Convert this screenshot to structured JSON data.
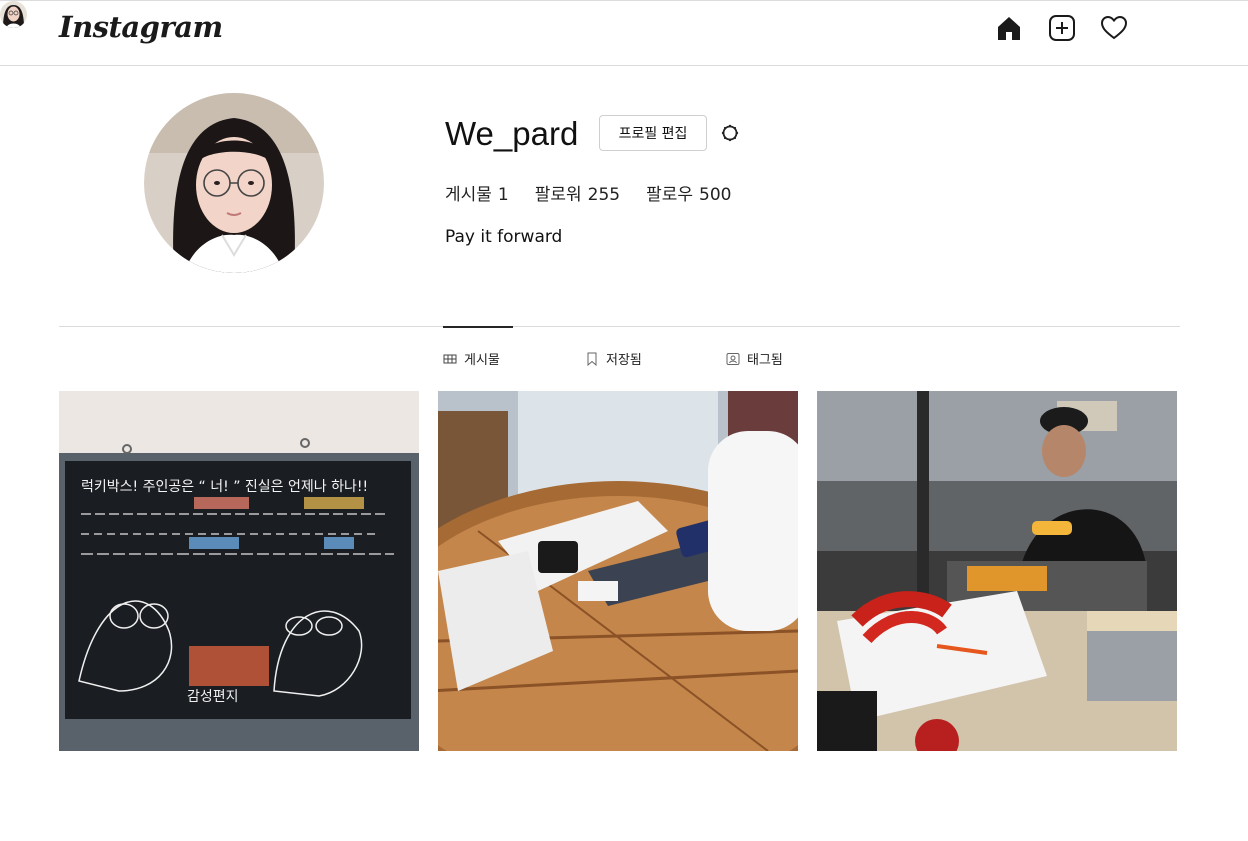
{
  "header": {
    "logo_text": "Instagram",
    "icons": [
      "home-icon",
      "new-post-icon",
      "heart-icon",
      "profile-avatar"
    ]
  },
  "profile": {
    "username": "We_pard",
    "edit_button_label": "프로필 편집",
    "stats": [
      {
        "label": "게시물",
        "value": "1"
      },
      {
        "label": "팔로워",
        "value": "255"
      },
      {
        "label": "팔로우",
        "value": "500"
      }
    ],
    "bio": "Pay it forward"
  },
  "tabs": [
    {
      "label": "게시물",
      "icon": "grid-icon",
      "active": true
    },
    {
      "label": "저장됨",
      "icon": "bookmark-icon",
      "active": false
    },
    {
      "label": "태그됨",
      "icon": "tag-user-icon",
      "active": false
    }
  ],
  "posts": {
    "post1_board_lines": [
      "럭키박스! 주인공은 “ 너! ” 진실은 언제나 하나!!",
      "감성편지"
    ]
  },
  "colors": {
    "border": "#dbdbdb",
    "text": "#111111",
    "active_tab": "#262626"
  }
}
